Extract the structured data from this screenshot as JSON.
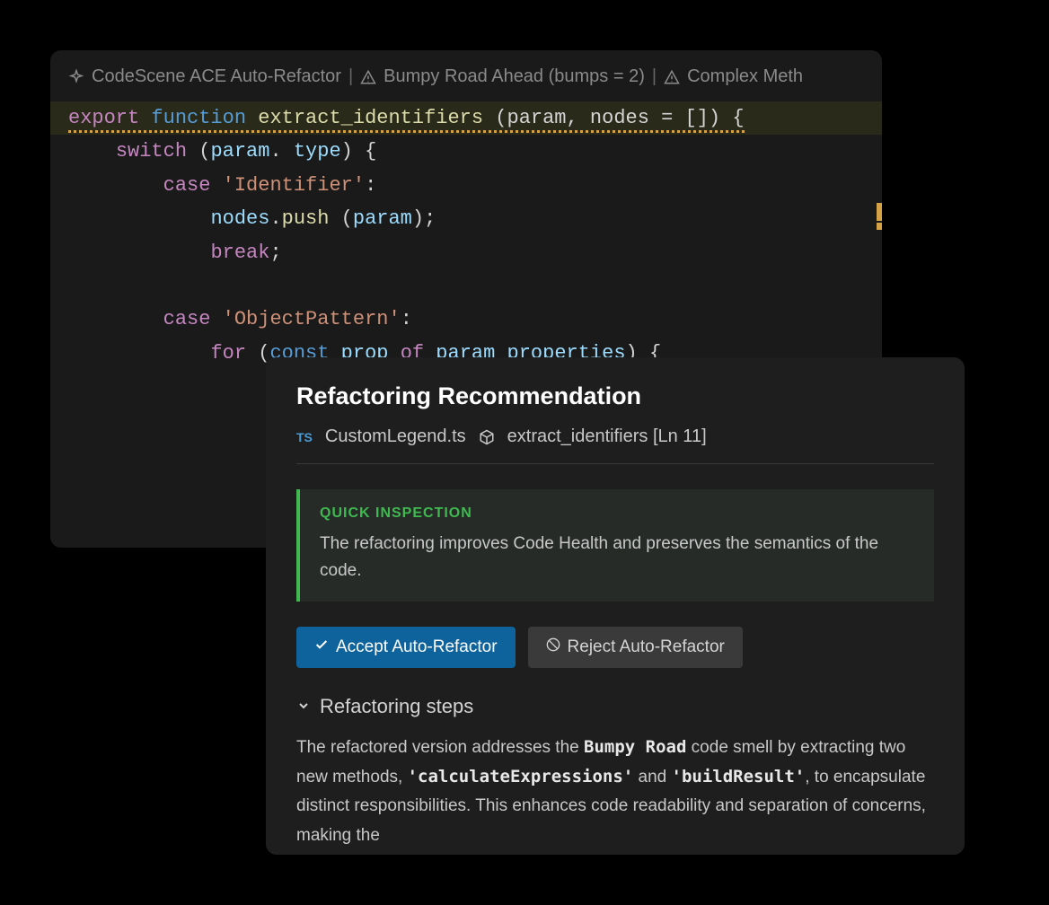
{
  "editor": {
    "code_lens": {
      "item1": "CodeScene ACE Auto-Refactor",
      "item2": "Bumpy Road Ahead (bumps = 2)",
      "item3": "Complex Meth"
    },
    "code": {
      "line1": {
        "export": "export",
        "function": "function",
        "name": "extract_identifiers",
        "params": " (param, nodes = []) {"
      },
      "line2": {
        "indent": "    ",
        "switch": "switch",
        "open": " (",
        "param": "param",
        "dot": ". ",
        "type": "type",
        "close": ") {"
      },
      "line3": {
        "indent": "        ",
        "case": "case",
        "space": " ",
        "string": "'Identifier'",
        "colon": ":"
      },
      "line4": {
        "indent": "            ",
        "nodes": "nodes",
        "dot": ".",
        "push": "push",
        "open": " (",
        "param": "param",
        "close": ");"
      },
      "line5": {
        "indent": "            ",
        "break": "break",
        "semi": ";"
      },
      "line6": {
        "indent": "        ",
        "case": "case",
        "space": " ",
        "string": "'ObjectPattern'",
        "colon": ":"
      },
      "line7": {
        "indent": "            ",
        "for": "for",
        "open": " (",
        "const": "const",
        "space": " ",
        "prop": "prop",
        "space2": " ",
        "of": "of",
        "space3": " ",
        "param": "param",
        "space4": " ",
        "properties": "properties",
        "close": ") {"
      }
    }
  },
  "popup": {
    "title": "Refactoring Recommendation",
    "ts_badge": "TS",
    "filename": "CustomLegend.ts",
    "function_ref": "extract_identifiers [Ln 11]",
    "inspection": {
      "label": "QUICK INSPECTION",
      "text": "The refactoring improves Code Health and preserves the semantics of the code."
    },
    "buttons": {
      "accept": "Accept Auto-Refactor",
      "reject": "Reject Auto-Refactor"
    },
    "steps": {
      "header": "Refactoring steps",
      "text_p1": "The refactored version addresses the ",
      "bold1": "Bumpy Road",
      "text_p2": " code smell by extracting two new methods, ",
      "code1": "'calculateExpressions'",
      "text_p3": " and ",
      "code2": "'buildResult'",
      "text_p4": ", to encapsulate distinct responsibilities. This enhances code readability and separation of concerns, making the"
    }
  }
}
